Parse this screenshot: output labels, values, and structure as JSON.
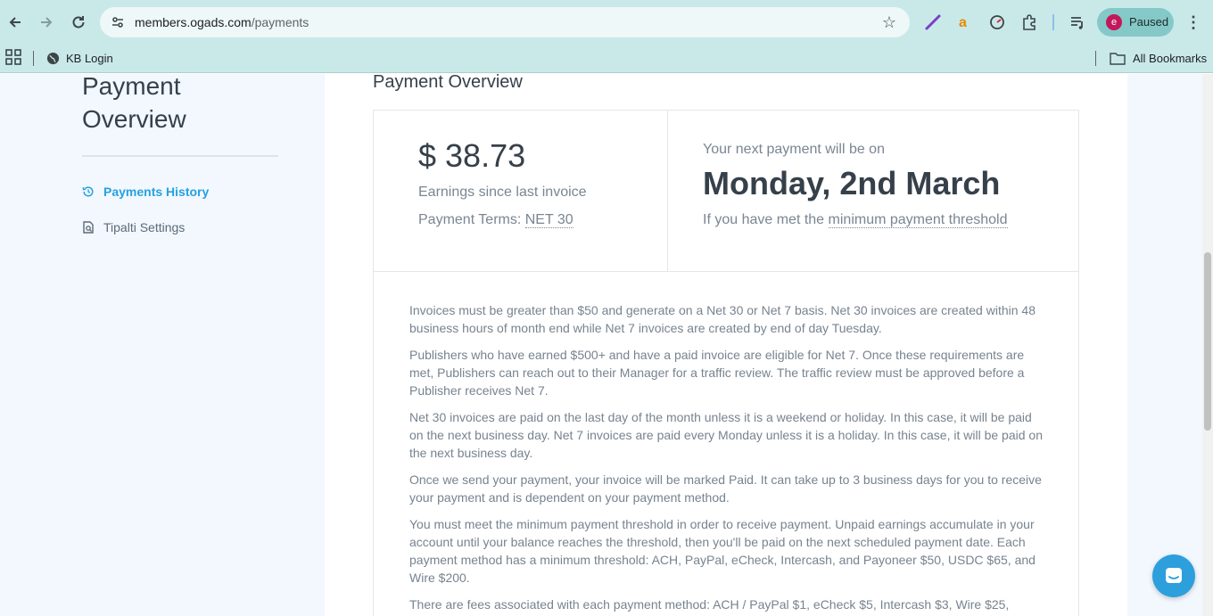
{
  "browser": {
    "url_host": "members.ogads.com",
    "url_path": "/payments",
    "profile_initial": "e",
    "profile_status": "Paused",
    "bookmarks": [
      {
        "label": "KB Login",
        "icon": "globe-icon"
      }
    ],
    "all_bookmarks_label": "All Bookmarks"
  },
  "sidebar": {
    "title": "Payment Overview",
    "items": [
      {
        "label": "Payments History",
        "icon": "history-icon",
        "active": true
      },
      {
        "label": "Tipalti Settings",
        "icon": "document-search-icon",
        "active": false
      }
    ]
  },
  "main": {
    "title": "Payment Overview",
    "earnings": {
      "amount": "$ 38.73",
      "caption": "Earnings since last invoice",
      "terms_label": "Payment Terms:",
      "terms_value": "NET 30"
    },
    "next_payment": {
      "label": "Your next payment will be on",
      "date": "Monday, 2nd March",
      "note_prefix": "If you have met the",
      "note_link": "minimum payment threshold"
    },
    "paragraphs": [
      "Invoices must be greater than $50 and generate on a Net 30 or Net 7 basis. Net 30 invoices are created within 48 business hours of month end while Net 7 invoices are created by end of day Tuesday.",
      "Publishers who have earned $500+ and have a paid invoice are eligible for Net 7. Once these requirements are met, Publishers can reach out to their Manager for a traffic review. The traffic review must be approved before a Publisher receives Net 7.",
      "Net 30 invoices are paid on the last day of the month unless it is a weekend or holiday. In this case, it will be paid on the next business day. Net 7 invoices are paid every Monday unless it is a holiday. In this case, it will be paid on the next business day.",
      "Once we send your payment, your invoice will be marked Paid. It can take up to 3 business days for you to receive your payment and is dependent on your payment method.",
      "You must meet the minimum payment threshold in order to receive payment. Unpaid earnings accumulate in your account until your balance reaches the threshold, then you'll be paid on the next scheduled payment date. Each payment method has a minimum threshold: ACH, PayPal, eCheck, Intercash, and Payoneer $50, USDC $65, and Wire $200.",
      "There are fees associated with each payment method: ACH / PayPal $1, eCheck $5, Intercash $3, Wire $25,"
    ]
  },
  "colors": {
    "chrome": "#c9e9e9",
    "accent": "#26a1e0",
    "heading": "#36404a",
    "muted": "#7a8693",
    "sidebar_bg": "#f2f8fd",
    "chat_bubble": "#2d9fdc"
  }
}
